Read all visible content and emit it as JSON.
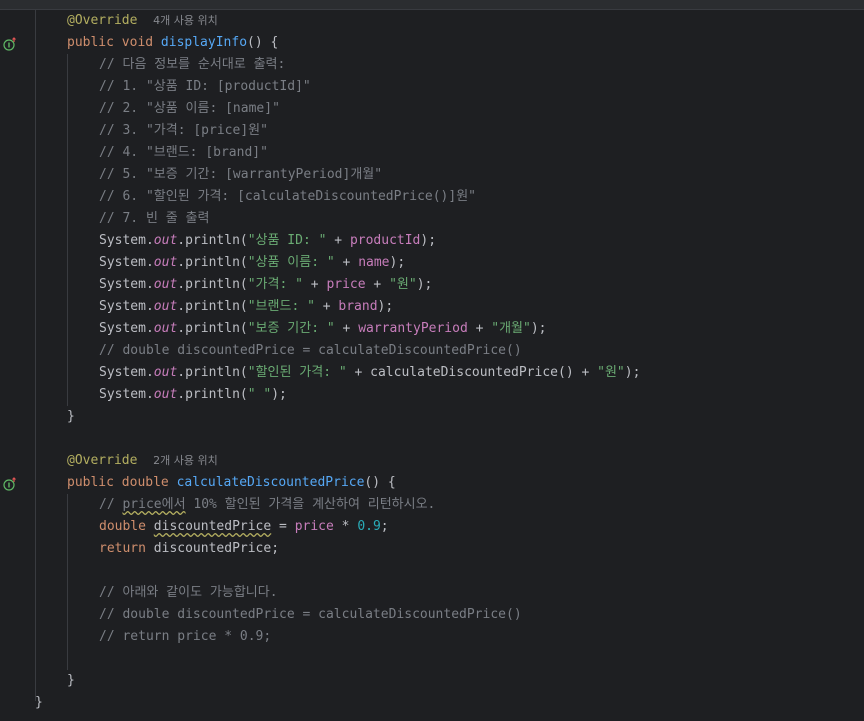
{
  "editor": {
    "gutter_icons": [
      {
        "name": "override-icon",
        "line": 2
      },
      {
        "name": "override-icon",
        "line": 22
      }
    ],
    "lines": [
      {
        "indent": 1,
        "tokens": [
          {
            "t": "@Override",
            "c": "ann"
          },
          {
            "t": "  ",
            "c": ""
          },
          {
            "t": "4개 사용 위치",
            "c": "hint"
          }
        ]
      },
      {
        "indent": 1,
        "tokens": [
          {
            "t": "public void ",
            "c": "kw"
          },
          {
            "t": "displayInfo",
            "c": "fn"
          },
          {
            "t": "() {",
            "c": ""
          }
        ]
      },
      {
        "indent": 2,
        "tokens": [
          {
            "t": "// 다음 정보를 순서대로 출력:",
            "c": "cmt"
          }
        ]
      },
      {
        "indent": 2,
        "tokens": [
          {
            "t": "// 1. \"상품 ID: [productId]\"",
            "c": "cmt"
          }
        ]
      },
      {
        "indent": 2,
        "tokens": [
          {
            "t": "// 2. \"상품 이름: [name]\"",
            "c": "cmt"
          }
        ]
      },
      {
        "indent": 2,
        "tokens": [
          {
            "t": "// 3. \"가격: [price]원\"",
            "c": "cmt"
          }
        ]
      },
      {
        "indent": 2,
        "tokens": [
          {
            "t": "// 4. \"브랜드: [brand]\"",
            "c": "cmt"
          }
        ]
      },
      {
        "indent": 2,
        "tokens": [
          {
            "t": "// 5. \"보증 기간: [warrantyPeriod]개월\"",
            "c": "cmt"
          }
        ]
      },
      {
        "indent": 2,
        "tokens": [
          {
            "t": "// 6. \"할인된 가격: [calculateDiscountedPrice()]원\"",
            "c": "cmt"
          }
        ]
      },
      {
        "indent": 2,
        "tokens": [
          {
            "t": "// 7. 빈 줄 출력",
            "c": "cmt"
          }
        ]
      },
      {
        "indent": 2,
        "tokens": [
          {
            "t": "System.",
            "c": ""
          },
          {
            "t": "out",
            "c": "st"
          },
          {
            "t": ".println(",
            "c": ""
          },
          {
            "t": "\"상품 ID: \"",
            "c": "str"
          },
          {
            "t": " + ",
            "c": ""
          },
          {
            "t": "productId",
            "c": "fld"
          },
          {
            "t": ");",
            "c": ""
          }
        ]
      },
      {
        "indent": 2,
        "tokens": [
          {
            "t": "System.",
            "c": ""
          },
          {
            "t": "out",
            "c": "st"
          },
          {
            "t": ".println(",
            "c": ""
          },
          {
            "t": "\"상품 이름: \"",
            "c": "str"
          },
          {
            "t": " + ",
            "c": ""
          },
          {
            "t": "name",
            "c": "fld"
          },
          {
            "t": ");",
            "c": ""
          }
        ]
      },
      {
        "indent": 2,
        "tokens": [
          {
            "t": "System.",
            "c": ""
          },
          {
            "t": "out",
            "c": "st"
          },
          {
            "t": ".println(",
            "c": ""
          },
          {
            "t": "\"가격: \"",
            "c": "str"
          },
          {
            "t": " + ",
            "c": ""
          },
          {
            "t": "price",
            "c": "fld"
          },
          {
            "t": " + ",
            "c": ""
          },
          {
            "t": "\"원\"",
            "c": "str"
          },
          {
            "t": ");",
            "c": ""
          }
        ]
      },
      {
        "indent": 2,
        "tokens": [
          {
            "t": "System.",
            "c": ""
          },
          {
            "t": "out",
            "c": "st"
          },
          {
            "t": ".println(",
            "c": ""
          },
          {
            "t": "\"브랜드: \"",
            "c": "str"
          },
          {
            "t": " + ",
            "c": ""
          },
          {
            "t": "brand",
            "c": "fld"
          },
          {
            "t": ");",
            "c": ""
          }
        ]
      },
      {
        "indent": 2,
        "tokens": [
          {
            "t": "System.",
            "c": ""
          },
          {
            "t": "out",
            "c": "st"
          },
          {
            "t": ".println(",
            "c": ""
          },
          {
            "t": "\"보증 기간: \"",
            "c": "str"
          },
          {
            "t": " + ",
            "c": ""
          },
          {
            "t": "warrantyPeriod",
            "c": "fld"
          },
          {
            "t": " + ",
            "c": ""
          },
          {
            "t": "\"개월\"",
            "c": "str"
          },
          {
            "t": ");",
            "c": ""
          }
        ]
      },
      {
        "indent": 2,
        "tokens": [
          {
            "t": "// double discountedPrice = calculateDiscountedPrice()",
            "c": "cmt"
          }
        ]
      },
      {
        "indent": 2,
        "tokens": [
          {
            "t": "System.",
            "c": ""
          },
          {
            "t": "out",
            "c": "st"
          },
          {
            "t": ".println(",
            "c": ""
          },
          {
            "t": "\"할인된 가격: \"",
            "c": "str"
          },
          {
            "t": " + calculateDiscountedPrice() + ",
            "c": ""
          },
          {
            "t": "\"원\"",
            "c": "str"
          },
          {
            "t": ");",
            "c": ""
          }
        ]
      },
      {
        "indent": 2,
        "tokens": [
          {
            "t": "System.",
            "c": ""
          },
          {
            "t": "out",
            "c": "st"
          },
          {
            "t": ".println(",
            "c": ""
          },
          {
            "t": "\" \"",
            "c": "str"
          },
          {
            "t": ");",
            "c": ""
          }
        ]
      },
      {
        "indent": 1,
        "tokens": [
          {
            "t": "}",
            "c": ""
          }
        ]
      },
      {
        "indent": 0,
        "tokens": []
      },
      {
        "indent": 1,
        "tokens": [
          {
            "t": "@Override",
            "c": "ann"
          },
          {
            "t": "  ",
            "c": ""
          },
          {
            "t": "2개 사용 위치",
            "c": "hint"
          }
        ]
      },
      {
        "indent": 1,
        "tokens": [
          {
            "t": "public double ",
            "c": "kw"
          },
          {
            "t": "calculateDiscountedPrice",
            "c": "fn"
          },
          {
            "t": "() {",
            "c": ""
          }
        ]
      },
      {
        "indent": 2,
        "tokens": [
          {
            "t": "// ",
            "c": "cmt"
          },
          {
            "t": "price에서",
            "c": "cmt typo"
          },
          {
            "t": " 10% 할인된 가격을 계산하여 리턴하시오.",
            "c": "cmt"
          }
        ]
      },
      {
        "indent": 2,
        "tokens": [
          {
            "t": "double ",
            "c": "kw"
          },
          {
            "t": "discountedPrice",
            "c": "typo"
          },
          {
            "t": " = ",
            "c": ""
          },
          {
            "t": "price",
            "c": "fld"
          },
          {
            "t": " * ",
            "c": ""
          },
          {
            "t": "0.9",
            "c": "num"
          },
          {
            "t": ";",
            "c": ""
          }
        ]
      },
      {
        "indent": 2,
        "tokens": [
          {
            "t": "return ",
            "c": "kw"
          },
          {
            "t": "discountedPrice;",
            "c": ""
          }
        ]
      },
      {
        "indent": 0,
        "tokens": []
      },
      {
        "indent": 2,
        "tokens": [
          {
            "t": "// 아래와 같이도 가능합니다.",
            "c": "cmt"
          }
        ]
      },
      {
        "indent": 2,
        "tokens": [
          {
            "t": "// double discountedPrice = calculateDiscountedPrice()",
            "c": "cmt"
          }
        ]
      },
      {
        "indent": 2,
        "tokens": [
          {
            "t": "// return price * 0.9;",
            "c": "cmt"
          }
        ]
      },
      {
        "indent": 0,
        "tokens": []
      },
      {
        "indent": 1,
        "tokens": [
          {
            "t": "}",
            "c": ""
          }
        ]
      },
      {
        "indent": 0,
        "tokens": [
          {
            "t": "}",
            "c": ""
          }
        ]
      }
    ]
  }
}
